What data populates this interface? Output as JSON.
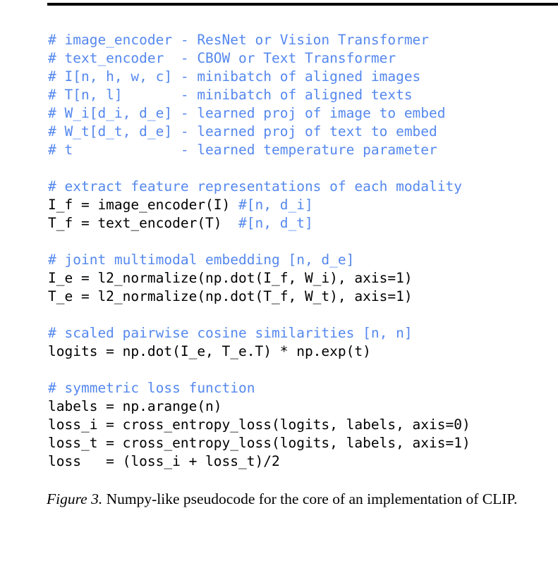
{
  "figure": {
    "rule_color": "#000000",
    "comment_color": "#5588ee",
    "code_color": "#000000",
    "caption_label": "Figure 3.",
    "caption_text": " Numpy-like pseudocode for the core of an implementation of CLIP.",
    "code_lines": [
      {
        "type": "comment",
        "text": "# image_encoder - ResNet or Vision Transformer"
      },
      {
        "type": "comment",
        "text": "# text_encoder  - CBOW or Text Transformer"
      },
      {
        "type": "comment",
        "text": "# I[n, h, w, c] - minibatch of aligned images"
      },
      {
        "type": "comment",
        "text": "# T[n, l]       - minibatch of aligned texts"
      },
      {
        "type": "comment",
        "text": "# W_i[d_i, d_e] - learned proj of image to embed"
      },
      {
        "type": "comment",
        "text": "# W_t[d_t, d_e] - learned proj of text to embed"
      },
      {
        "type": "comment",
        "text": "# t             - learned temperature parameter"
      },
      {
        "type": "blank",
        "text": ""
      },
      {
        "type": "comment",
        "text": "# extract feature representations of each modality"
      },
      {
        "type": "mixed",
        "code": "I_f = image_encoder(I) ",
        "comment": "#[n, d_i]"
      },
      {
        "type": "mixed",
        "code": "T_f = text_encoder(T)  ",
        "comment": "#[n, d_t]"
      },
      {
        "type": "blank",
        "text": ""
      },
      {
        "type": "comment",
        "text": "# joint multimodal embedding [n, d_e]"
      },
      {
        "type": "code",
        "text": "I_e = l2_normalize(np.dot(I_f, W_i), axis=1)"
      },
      {
        "type": "code",
        "text": "T_e = l2_normalize(np.dot(T_f, W_t), axis=1)"
      },
      {
        "type": "blank",
        "text": ""
      },
      {
        "type": "comment",
        "text": "# scaled pairwise cosine similarities [n, n]"
      },
      {
        "type": "code",
        "text": "logits = np.dot(I_e, T_e.T) * np.exp(t)"
      },
      {
        "type": "blank",
        "text": ""
      },
      {
        "type": "comment",
        "text": "# symmetric loss function"
      },
      {
        "type": "code",
        "text": "labels = np.arange(n)"
      },
      {
        "type": "code",
        "text": "loss_i = cross_entropy_loss(logits, labels, axis=0)"
      },
      {
        "type": "code",
        "text": "loss_t = cross_entropy_loss(logits, labels, axis=1)"
      },
      {
        "type": "code",
        "text": "loss   = (loss_i + loss_t)/2"
      }
    ]
  }
}
